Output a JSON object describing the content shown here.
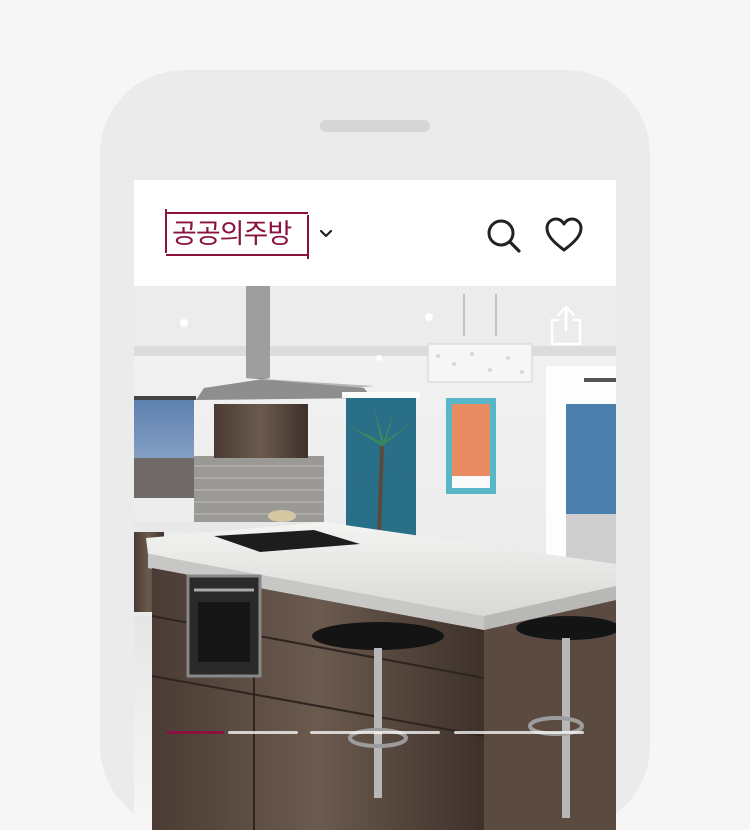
{
  "header": {
    "logo_text": "공공의주방",
    "icons": [
      "chevron-down-icon",
      "search-icon",
      "heart-icon"
    ]
  },
  "hero": {
    "image": "kitchen-island-photo",
    "share_icon": "share-icon",
    "carousel": {
      "count": 4,
      "active_index": 0
    }
  },
  "colors": {
    "brand": "#8a1240",
    "phone_frame": "#ebebeb",
    "background": "#f6f6f6"
  }
}
